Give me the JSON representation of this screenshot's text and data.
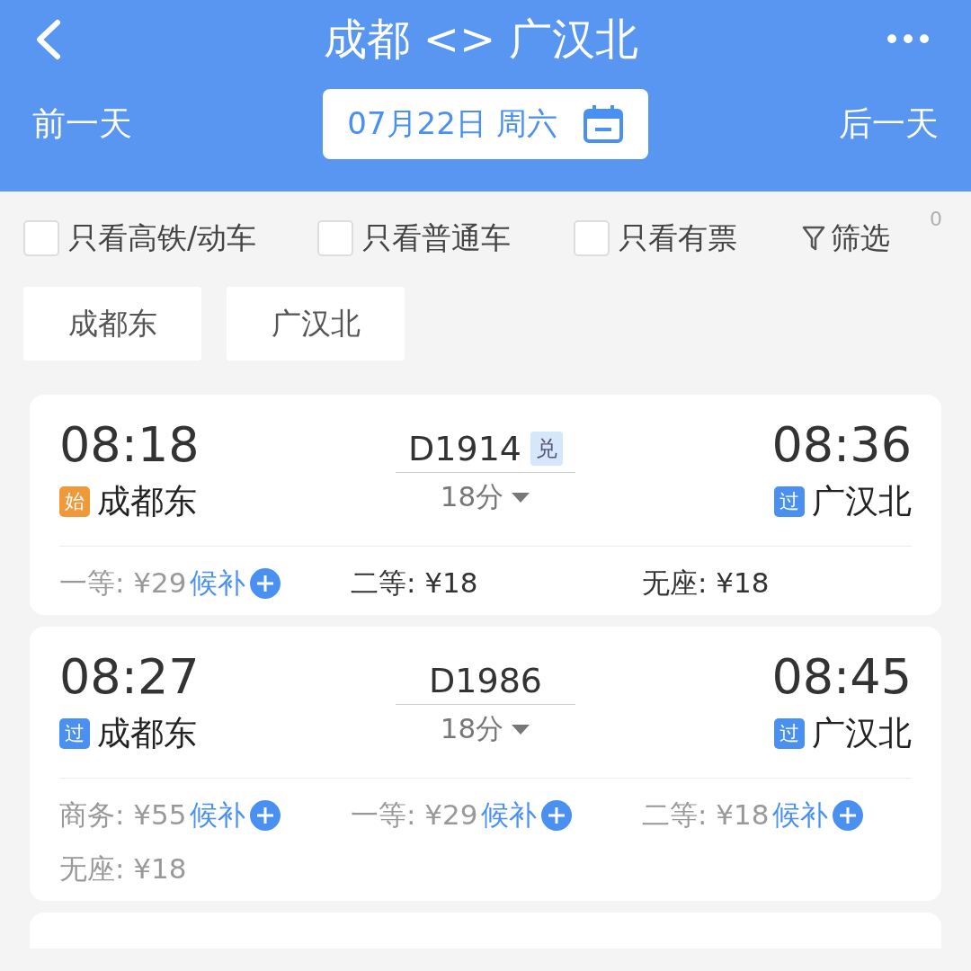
{
  "header": {
    "title": "成都 <> 广汉北",
    "more": "•••",
    "prev_day": "前一天",
    "date": "07月22日 周六",
    "next_day": "后一天"
  },
  "filters": [
    {
      "label": "只看高铁/动车",
      "checked": false
    },
    {
      "label": "只看普通车",
      "checked": false
    },
    {
      "label": "只看有票",
      "checked": false
    }
  ],
  "filter_button": {
    "label": "筛选",
    "count": "0"
  },
  "stations": [
    "成都东",
    "广汉北"
  ],
  "trains": [
    {
      "depart_time": "08:18",
      "depart_tag": {
        "text": "始",
        "color": "#f0993a"
      },
      "depart_station": "成都东",
      "train_no": "D1914",
      "badge": "兑",
      "duration": "18分",
      "arrive_time": "08:36",
      "arrive_tag": {
        "text": "过",
        "color": "#4a90f0"
      },
      "arrive_station": "广汉北",
      "seats": [
        {
          "text": "一等: ¥29",
          "available": false,
          "waitlist": "候补"
        },
        {
          "text": "二等: ¥18",
          "available": true
        },
        {
          "text": "无座: ¥18",
          "available": true
        }
      ]
    },
    {
      "depart_time": "08:27",
      "depart_tag": {
        "text": "过",
        "color": "#4a90f0"
      },
      "depart_station": "成都东",
      "train_no": "D1986",
      "duration": "18分",
      "arrive_time": "08:45",
      "arrive_tag": {
        "text": "过",
        "color": "#4a90f0"
      },
      "arrive_station": "广汉北",
      "seats": [
        {
          "text": "商务: ¥55",
          "available": false,
          "waitlist": "候补"
        },
        {
          "text": "一等: ¥29",
          "available": false,
          "waitlist": "候补"
        },
        {
          "text": "二等: ¥18",
          "available": false,
          "waitlist": "候补"
        },
        {
          "text": "无座: ¥18",
          "available": false
        }
      ]
    }
  ]
}
